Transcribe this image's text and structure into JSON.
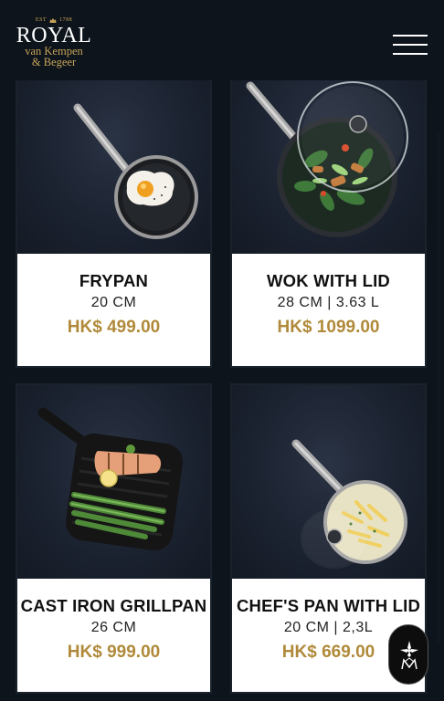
{
  "brand": {
    "est_left": "EST",
    "est_right": "1788",
    "name_line1": "ROYAL",
    "name_line2": "van Kempen",
    "name_line3": "& Begeer",
    "accent_color": "#c8a45a"
  },
  "header": {
    "menu_icon": "hamburger-menu-icon"
  },
  "products": [
    {
      "name": "FRYPAN",
      "size": "20 CM",
      "price": "HK$ 499.00",
      "image": "frypan-with-egg"
    },
    {
      "name": "WOK WITH LID",
      "size": "28 CM | 3.63 L",
      "price": "HK$ 1099.00",
      "image": "wok-with-stirfry-and-lid"
    },
    {
      "name": "CAST IRON GRILLPAN",
      "size": "26 CM",
      "price": "HK$ 999.00",
      "image": "grillpan-with-salmon-and-asparagus"
    },
    {
      "name": "CHEF'S PAN WITH LID",
      "size": "20 CM | 2,3L",
      "price": "HK$ 669.00",
      "image": "chefs-pan-with-pasta-and-lid"
    }
  ],
  "floating_button": {
    "icon": "brand-emblem-icon"
  },
  "colors": {
    "background": "#0d141b",
    "price": "#b08a3a",
    "card": "#ffffff"
  }
}
